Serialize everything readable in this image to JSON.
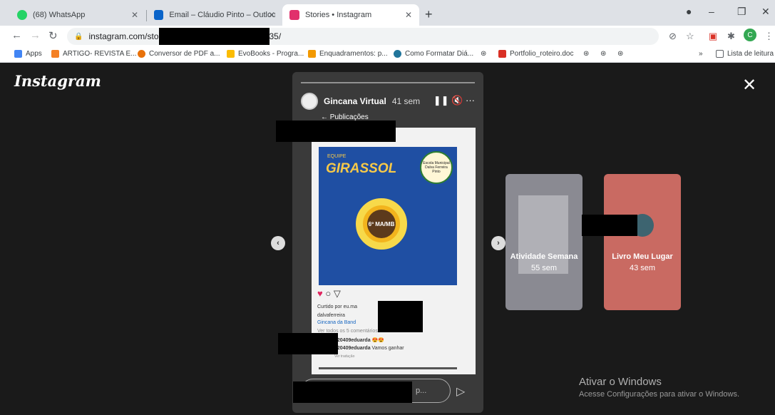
{
  "browser": {
    "tabs": [
      {
        "label": "(68) WhatsApp"
      },
      {
        "label": "Email – Cláudio Pinto – Outlook"
      },
      {
        "label": "Stories • Instagram"
      }
    ],
    "url_prefix": "instagram.com/sto",
    "url_suffix": "35/",
    "bookmarks": [
      {
        "label": "Apps"
      },
      {
        "label": "ARTIGO- REVISTA E..."
      },
      {
        "label": "Conversor de PDF a..."
      },
      {
        "label": "EvoBooks - Progra..."
      },
      {
        "label": "Enquadramentos: p..."
      },
      {
        "label": "Como Formatar Diá..."
      },
      {
        "label": "Portfolio_roteiro.doc"
      }
    ],
    "reading_list": "Lista de leitura",
    "more_bookmarks": "»",
    "profile_initial": "C"
  },
  "page": {
    "logo": "Instagram",
    "close": "✕",
    "story": {
      "account": "Gincana Virtual",
      "time": "41 sem",
      "publications_label": "Publicações",
      "team_label": "EQUIPE",
      "team_name": "GIRASSOL",
      "class_label": "6º MA/MB",
      "school_seal": "Escola Municipal Dalva Ferreira Pinto",
      "liked_by": "Curtido por eu.ma",
      "caption_user": "dalvaferreira",
      "caption_text": "Gincana da Band",
      "view_comments": "Ver todos os 5 comentários",
      "comment1_user": "120409eduarda",
      "comment1_text": "😍😍",
      "comment2_user": "120409eduarda",
      "comment2_text": "Vamos ganhar",
      "see_translation": "Ver tradução",
      "reply_placeholder": "p..."
    },
    "next_stories": [
      {
        "title": "Atividade Semana",
        "time": "55 sem"
      },
      {
        "title": "Livro Meu Lugar",
        "time": "43 sem"
      }
    ],
    "windows_activation": {
      "title": "Ativar o Windows",
      "subtitle": "Acesse Configurações para ativar o Windows."
    }
  }
}
